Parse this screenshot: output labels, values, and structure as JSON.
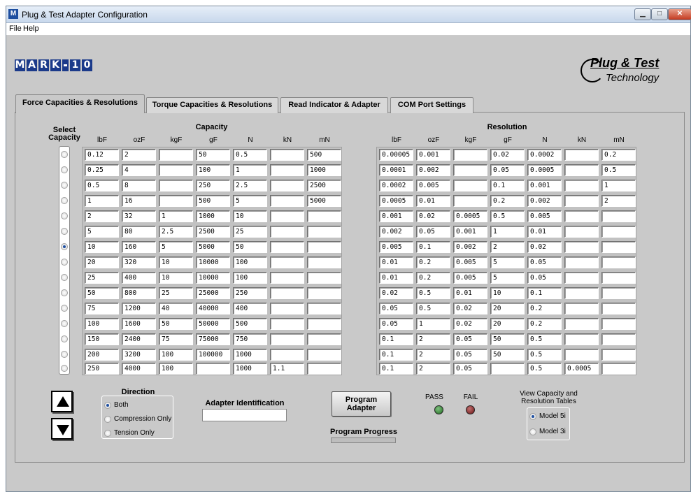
{
  "window": {
    "title": "Plug & Test Adapter Configuration",
    "icon_letter": "M"
  },
  "menu": {
    "file": "File",
    "help": "Help"
  },
  "logo": {
    "letters": [
      "M",
      "A",
      "R",
      "K",
      "-",
      "1",
      "0"
    ],
    "plugtest_line1": "Plug & Test",
    "plugtest_line2": "Technology"
  },
  "tabs": [
    "Force Capacities & Resolutions",
    "Torque Capacities & Resolutions",
    "Read Indicator & Adapter",
    "COM Port Settings"
  ],
  "headers": {
    "select_capacity": "Select Capacity",
    "capacity": "Capacity",
    "resolution": "Resolution"
  },
  "units": [
    "lbF",
    "ozF",
    "kgF",
    "gF",
    "N",
    "kN",
    "mN"
  ],
  "selected_row": 6,
  "capacity_rows": [
    [
      "0.12",
      "2",
      "",
      "50",
      "0.5",
      "",
      "500"
    ],
    [
      "0.25",
      "4",
      "",
      "100",
      "1",
      "",
      "1000"
    ],
    [
      "0.5",
      "8",
      "",
      "250",
      "2.5",
      "",
      "2500"
    ],
    [
      "1",
      "16",
      "",
      "500",
      "5",
      "",
      "5000"
    ],
    [
      "2",
      "32",
      "1",
      "1000",
      "10",
      "",
      ""
    ],
    [
      "5",
      "80",
      "2.5",
      "2500",
      "25",
      "",
      ""
    ],
    [
      "10",
      "160",
      "5",
      "5000",
      "50",
      "",
      ""
    ],
    [
      "20",
      "320",
      "10",
      "10000",
      "100",
      "",
      ""
    ],
    [
      "25",
      "400",
      "10",
      "10000",
      "100",
      "",
      ""
    ],
    [
      "50",
      "800",
      "25",
      "25000",
      "250",
      "",
      ""
    ],
    [
      "75",
      "1200",
      "40",
      "40000",
      "400",
      "",
      ""
    ],
    [
      "100",
      "1600",
      "50",
      "50000",
      "500",
      "",
      ""
    ],
    [
      "150",
      "2400",
      "75",
      "75000",
      "750",
      "",
      ""
    ],
    [
      "200",
      "3200",
      "100",
      "100000",
      "1000",
      "",
      ""
    ],
    [
      "250",
      "4000",
      "100",
      "",
      "1000",
      "1.1",
      ""
    ]
  ],
  "resolution_rows": [
    [
      "0.00005",
      "0.001",
      "",
      "0.02",
      "0.0002",
      "",
      "0.2"
    ],
    [
      "0.0001",
      "0.002",
      "",
      "0.05",
      "0.0005",
      "",
      "0.5"
    ],
    [
      "0.0002",
      "0.005",
      "",
      "0.1",
      "0.001",
      "",
      "1"
    ],
    [
      "0.0005",
      "0.01",
      "",
      "0.2",
      "0.002",
      "",
      "2"
    ],
    [
      "0.001",
      "0.02",
      "0.0005",
      "0.5",
      "0.005",
      "",
      ""
    ],
    [
      "0.002",
      "0.05",
      "0.001",
      "1",
      "0.01",
      "",
      ""
    ],
    [
      "0.005",
      "0.1",
      "0.002",
      "2",
      "0.02",
      "",
      ""
    ],
    [
      "0.01",
      "0.2",
      "0.005",
      "5",
      "0.05",
      "",
      ""
    ],
    [
      "0.01",
      "0.2",
      "0.005",
      "5",
      "0.05",
      "",
      ""
    ],
    [
      "0.02",
      "0.5",
      "0.01",
      "10",
      "0.1",
      "",
      ""
    ],
    [
      "0.05",
      "0.5",
      "0.02",
      "20",
      "0.2",
      "",
      ""
    ],
    [
      "0.05",
      "1",
      "0.02",
      "20",
      "0.2",
      "",
      ""
    ],
    [
      "0.1",
      "2",
      "0.05",
      "50",
      "0.5",
      "",
      ""
    ],
    [
      "0.1",
      "2",
      "0.05",
      "50",
      "0.5",
      "",
      ""
    ],
    [
      "0.1",
      "2",
      "0.05",
      "",
      "0.5",
      "0.0005",
      ""
    ]
  ],
  "direction": {
    "title": "Direction",
    "options": [
      "Both",
      "Compression Only",
      "Tension Only"
    ],
    "selected": 0
  },
  "adapter": {
    "label": "Adapter Identification",
    "value": ""
  },
  "program": {
    "button": "Program Adapter",
    "progress_label": "Program Progress",
    "progress": 0
  },
  "status": {
    "pass": "PASS",
    "fail": "FAIL",
    "pass_color": "#1f6b1f",
    "fail_color": "#6b1414"
  },
  "model": {
    "title": "View Capacity and Resolution Tables",
    "options": [
      "Model 5i",
      "Model 3i"
    ],
    "selected": 0
  }
}
